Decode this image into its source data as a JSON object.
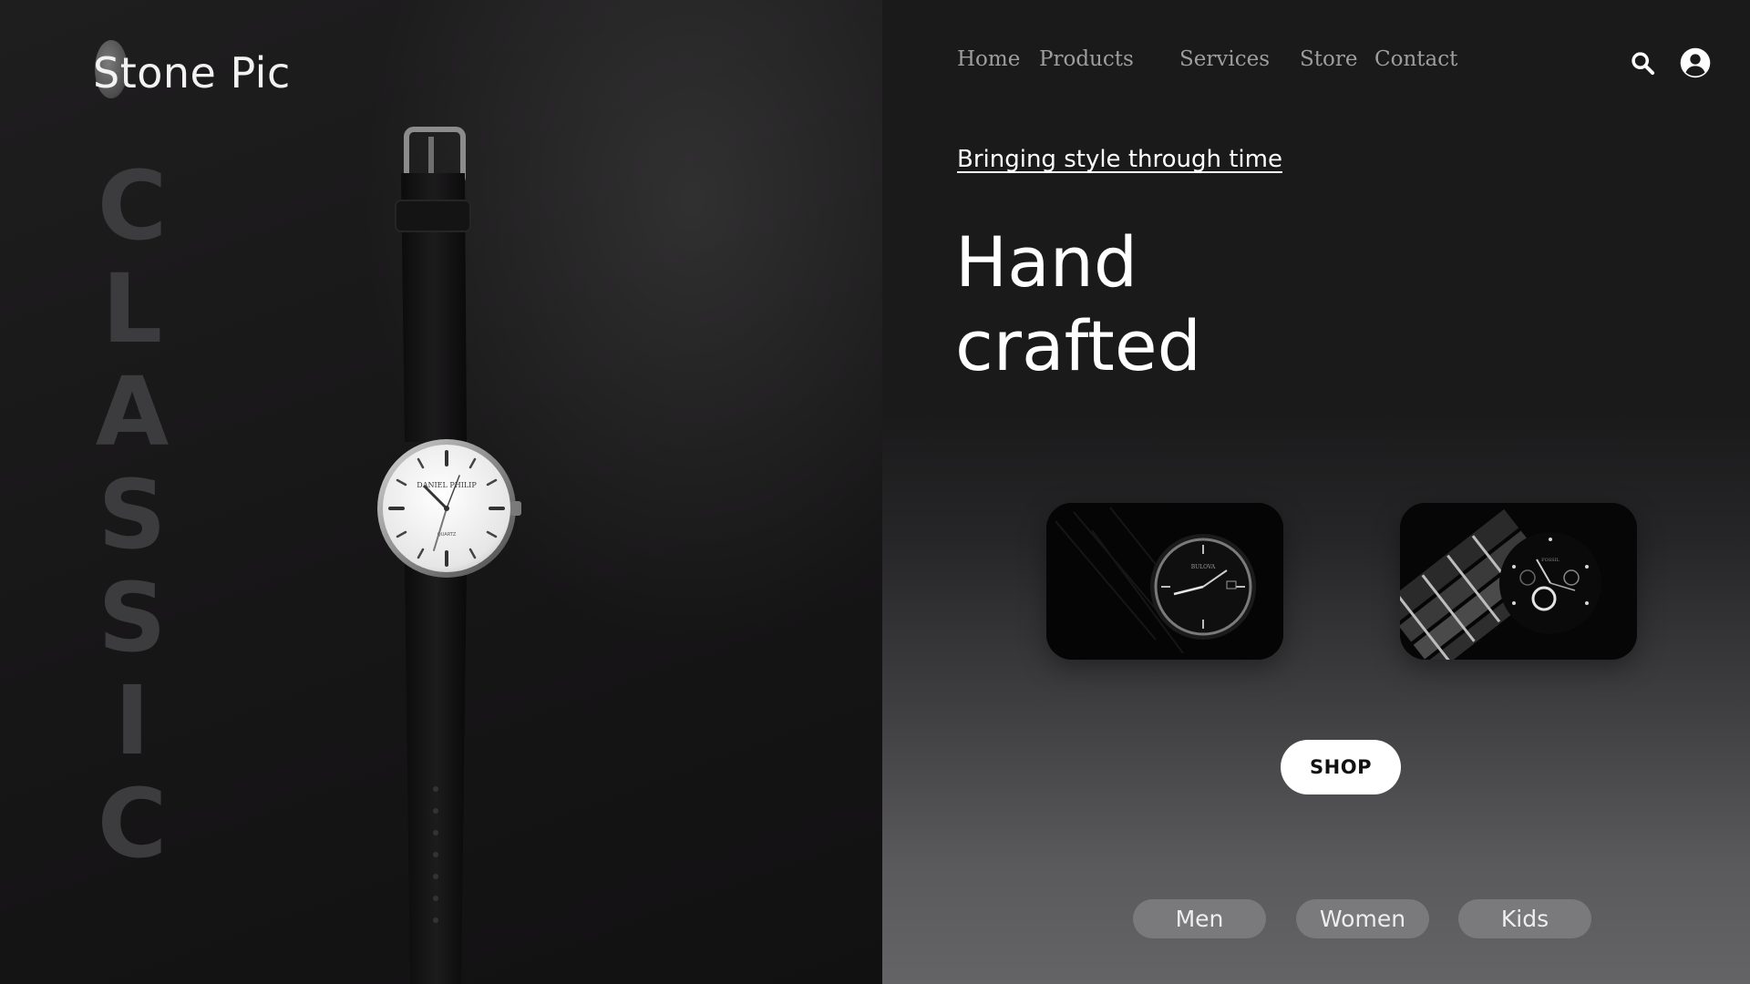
{
  "brand": {
    "name": "Stone Pic"
  },
  "hero": {
    "vertical_word_letters": [
      "C",
      "L",
      "A",
      "S",
      "S",
      "I",
      "C"
    ],
    "watch_dial_text": "DANIEL PHILIP",
    "watch_subdial_text": "QUARTZ"
  },
  "nav": {
    "items": [
      {
        "label": "Home"
      },
      {
        "label": "Products"
      },
      {
        "label": "Services"
      },
      {
        "label": "Store"
      },
      {
        "label": "Contact"
      }
    ],
    "icons": [
      "search-icon",
      "user-account-icon"
    ]
  },
  "main": {
    "tagline": "Bringing style through time",
    "headline_line1": "Hand",
    "headline_line2": "crafted",
    "products": [
      {
        "icon": "watch-photo-1",
        "dial_text": "BULOVA"
      },
      {
        "icon": "watch-photo-2",
        "dial_text": "FOSSIL"
      }
    ],
    "shop_label": "SHOP",
    "categories": [
      {
        "label": "Men"
      },
      {
        "label": "Women"
      },
      {
        "label": "Kids"
      }
    ]
  },
  "colors": {
    "background_dark": "#1b1a1b",
    "text_primary": "#ffffff",
    "nav_text": "#9e9e9e",
    "classic_letters": "#3c3b3d",
    "category_button": "#7a797b",
    "shop_button": "#ffffff"
  }
}
